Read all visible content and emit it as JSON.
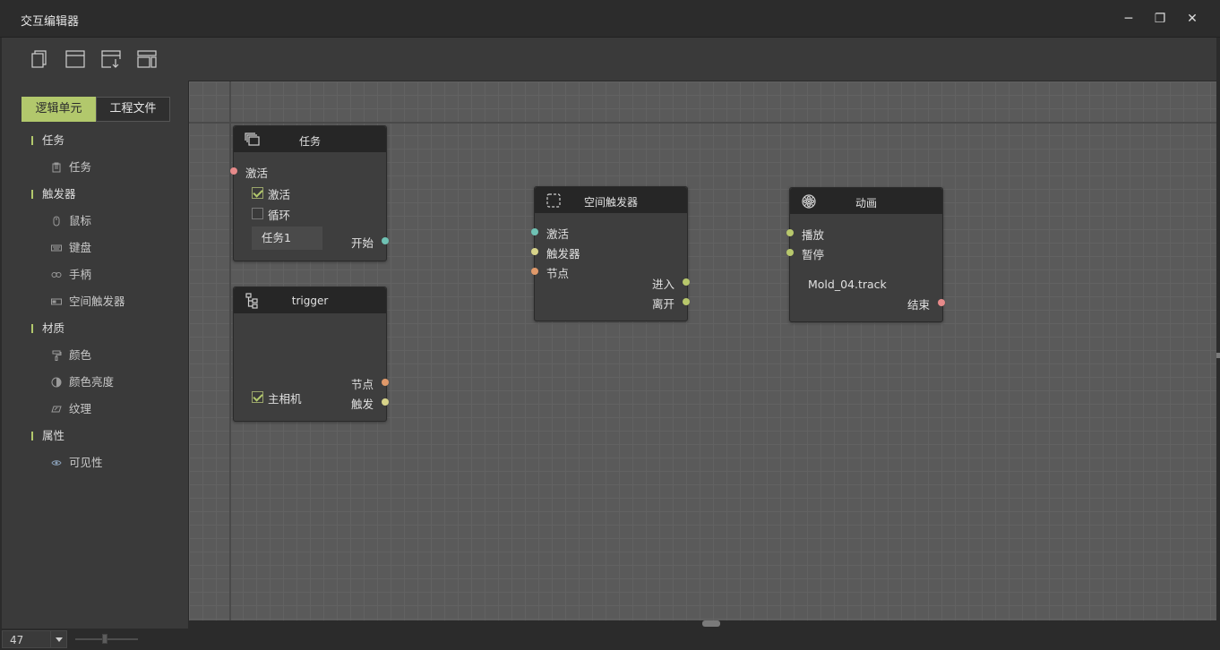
{
  "window": {
    "title": "交互编辑器",
    "minimize": "─",
    "restore": "❐",
    "close": "✕"
  },
  "toolbar": {
    "buttons": [
      "new-file-icon",
      "window-icon",
      "import-icon",
      "layout-icon"
    ]
  },
  "sidebar": {
    "tabs": [
      {
        "label": "逻辑单元",
        "active": true
      },
      {
        "label": "工程文件",
        "active": false
      }
    ],
    "groups": [
      {
        "label": "任务",
        "items": [
          {
            "label": "任务",
            "icon": "clipboard-icon"
          }
        ]
      },
      {
        "label": "触发器",
        "items": [
          {
            "label": "鼠标",
            "icon": "mouse-icon"
          },
          {
            "label": "键盘",
            "icon": "keyboard-icon"
          },
          {
            "label": "手柄",
            "icon": "gamepad-icon"
          },
          {
            "label": "空间触发器",
            "icon": "space-trigger-icon"
          }
        ]
      },
      {
        "label": "材质",
        "items": [
          {
            "label": "颜色",
            "icon": "paint-roller-icon"
          },
          {
            "label": "颜色亮度",
            "icon": "contrast-icon"
          },
          {
            "label": "纹理",
            "icon": "texture-icon"
          }
        ]
      },
      {
        "label": "属性",
        "items": [
          {
            "label": "可见性",
            "icon": "eye-icon"
          }
        ]
      }
    ]
  },
  "nodes": {
    "task": {
      "title": "任务",
      "input_activate": "激活",
      "check_activate": "激活",
      "check_activate_on": true,
      "check_loop": "循环",
      "check_loop_on": false,
      "field_value": "任务1",
      "output_start": "开始"
    },
    "trigger": {
      "title": "trigger",
      "check_main_camera": "主相机",
      "check_main_camera_on": true,
      "output_node": "节点",
      "output_fire": "触发"
    },
    "space_trigger": {
      "title": "空间触发器",
      "input_activate": "激活",
      "input_trigger": "触发器",
      "input_node": "节点",
      "output_enter": "进入",
      "output_leave": "离开"
    },
    "animation": {
      "title": "动画",
      "input_play": "播放",
      "input_pause": "暂停",
      "track_name": "Mold_04.track",
      "output_end": "结束"
    }
  },
  "colors": {
    "accent": "#b2c86c",
    "port_pink": "#e68a8a",
    "port_teal": "#6fc2b4",
    "port_yellow": "#d8d48a",
    "port_orange": "#e0996a",
    "port_green": "#b8c86c"
  },
  "statusbar": {
    "zoom_value": "47"
  }
}
